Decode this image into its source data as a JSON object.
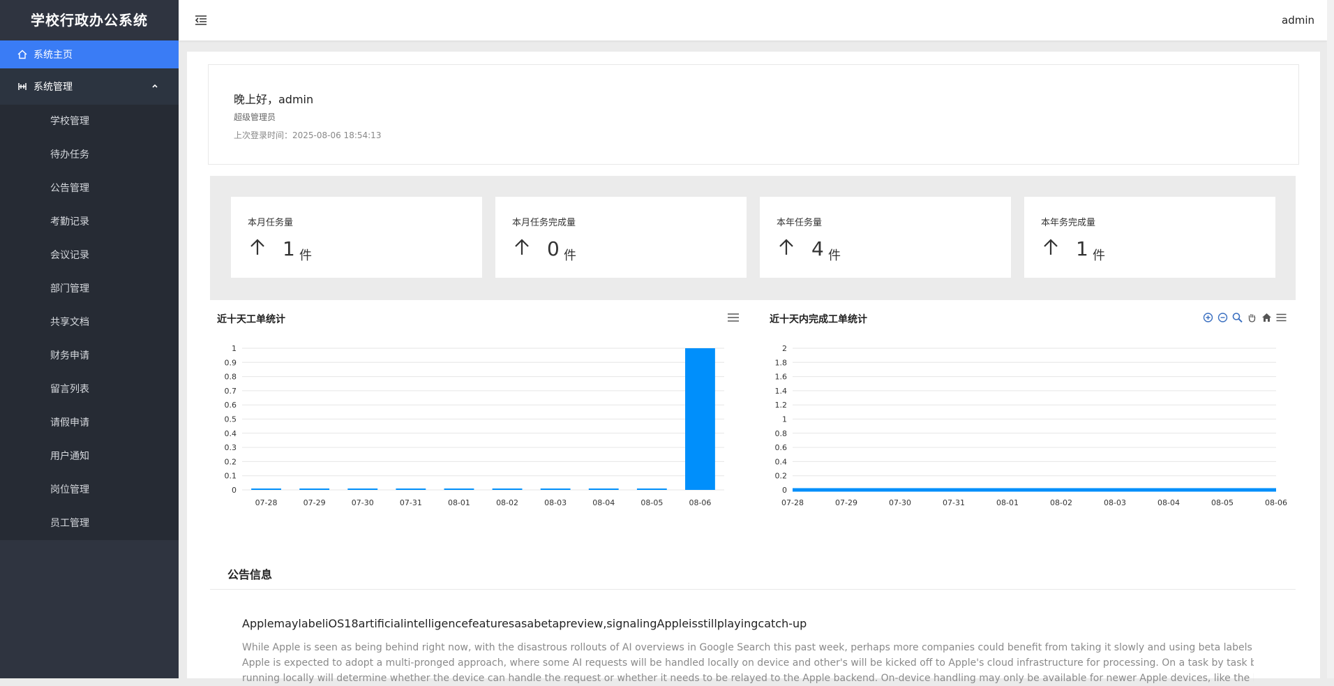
{
  "app": {
    "title": "学校行政办公系统",
    "user": "admin"
  },
  "sidebar": {
    "home_label": "系统主页",
    "group_label": "系统管理",
    "items": [
      {
        "label": "学校管理"
      },
      {
        "label": "待办任务"
      },
      {
        "label": "公告管理"
      },
      {
        "label": "考勤记录"
      },
      {
        "label": "会议记录"
      },
      {
        "label": "部门管理"
      },
      {
        "label": "共享文档"
      },
      {
        "label": "财务申请"
      },
      {
        "label": "留言列表"
      },
      {
        "label": "请假申请"
      },
      {
        "label": "用户通知"
      },
      {
        "label": "岗位管理"
      },
      {
        "label": "员工管理"
      }
    ]
  },
  "welcome": {
    "greeting": "晚上好，admin",
    "role": "超级管理员",
    "last_login": "上次登录时间：2025-08-06 18:54:13"
  },
  "stats": [
    {
      "label": "本月任务量",
      "value": "1",
      "unit": "件"
    },
    {
      "label": "本月任务完成量",
      "value": "0",
      "unit": "件"
    },
    {
      "label": "本年任务量",
      "value": "4",
      "unit": "件"
    },
    {
      "label": "本年务完成量",
      "value": "1",
      "unit": "件"
    }
  ],
  "colors": {
    "accent": "#3a7cf5",
    "bar": "#008ffb",
    "sidebar": "#2f3440"
  },
  "chart_data": [
    {
      "type": "bar",
      "title": "近十天工单统计",
      "categories": [
        "07-28",
        "07-29",
        "07-30",
        "07-31",
        "08-01",
        "08-02",
        "08-03",
        "08-04",
        "08-05",
        "08-06"
      ],
      "values": [
        0,
        0,
        0,
        0,
        0,
        0,
        0,
        0,
        0,
        1
      ],
      "yticks": [
        "0",
        "0.1",
        "0.2",
        "0.3",
        "0.4",
        "0.5",
        "0.6",
        "0.7",
        "0.8",
        "0.9",
        "1"
      ],
      "ylim": [
        0,
        1
      ],
      "grid": true,
      "toolbar": [
        "menu-icon"
      ]
    },
    {
      "type": "area",
      "title": "近十天内完成工单统计",
      "categories": [
        "07-28",
        "07-29",
        "07-30",
        "07-31",
        "08-01",
        "08-02",
        "08-03",
        "08-04",
        "08-05",
        "08-06"
      ],
      "values": [
        0,
        0,
        0,
        0,
        0,
        0,
        0,
        0,
        0,
        0
      ],
      "yticks": [
        "0",
        "0.2",
        "0.4",
        "0.6",
        "0.8",
        "1",
        "1.2",
        "1.4",
        "1.6",
        "1.8",
        "2"
      ],
      "ylim": [
        0,
        2
      ],
      "grid": true,
      "toolbar": [
        "zoom-in-icon",
        "zoom-out-icon",
        "search-zoom-icon",
        "pan-hand-icon",
        "home-icon",
        "menu-icon"
      ]
    }
  ],
  "notice": {
    "section_title": "公告信息",
    "title": "ApplemaylabeliOS18artificialintelligencefeaturesasabetapreview,signalingAppleisstillplayingcatch-up",
    "lines": [
      "While Apple is seen as being behind right now, with the disastrous rollouts of AI overviews in Google Search this past week, perhaps more companies could benefit from taking it slowly and using beta labels judiciously ...",
      "Apple is expected to adopt a multi-pronged approach, where some AI requests will be handled locally on device and other's will be kicked off to Apple's cloud infrastructure for processing. On a task by task basis, code",
      "running locally will determine whether the device can handle the request or whether it needs to be relayed to the Apple backend. On-device handling may only be available for newer Apple devices, like the latest one so two"
    ]
  }
}
